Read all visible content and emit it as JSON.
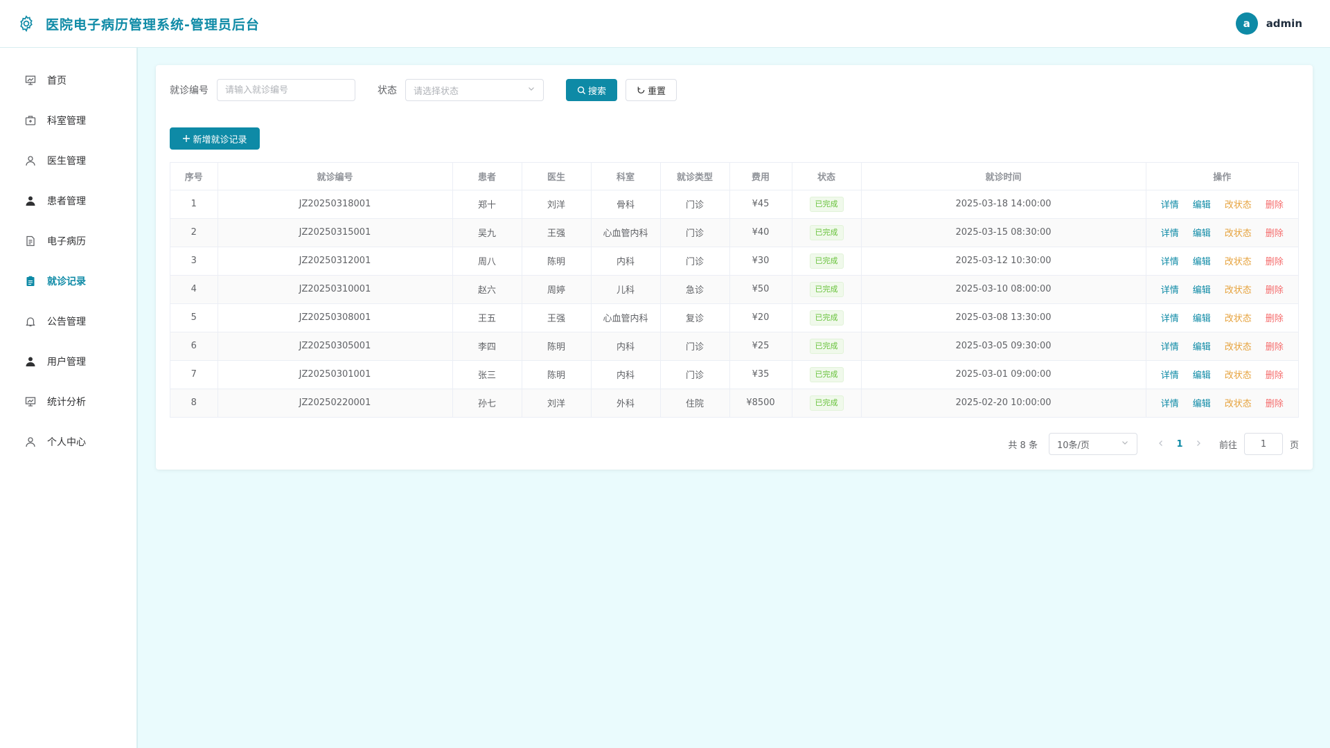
{
  "header": {
    "title": "医院电子病历管理系统-管理员后台",
    "avatar_letter": "a",
    "username": "admin"
  },
  "sidebar": {
    "items": [
      {
        "label": "首页",
        "icon": "dashboard-icon"
      },
      {
        "label": "科室管理",
        "icon": "department-icon"
      },
      {
        "label": "医生管理",
        "icon": "doctor-icon"
      },
      {
        "label": "患者管理",
        "icon": "patient-icon"
      },
      {
        "label": "电子病历",
        "icon": "document-icon"
      },
      {
        "label": "就诊记录",
        "icon": "clipboard-icon",
        "active": true
      },
      {
        "label": "公告管理",
        "icon": "bell-icon"
      },
      {
        "label": "用户管理",
        "icon": "user-icon"
      },
      {
        "label": "统计分析",
        "icon": "chart-icon"
      },
      {
        "label": "个人中心",
        "icon": "profile-icon"
      }
    ]
  },
  "filters": {
    "visit_no_label": "就诊编号",
    "visit_no_placeholder": "请输入就诊编号",
    "status_label": "状态",
    "status_placeholder": "请选择状态",
    "search_label": "搜索",
    "reset_label": "重置"
  },
  "toolbar": {
    "add_label": "新增就诊记录"
  },
  "table": {
    "columns": [
      "序号",
      "就诊编号",
      "患者",
      "医生",
      "科室",
      "就诊类型",
      "费用",
      "状态",
      "就诊时间",
      "操作"
    ],
    "actions": {
      "detail": "详情",
      "edit": "编辑",
      "change_status": "改状态",
      "delete": "删除"
    },
    "rows": [
      {
        "index": "1",
        "visit_no": "JZ20250318001",
        "patient": "郑十",
        "doctor": "刘洋",
        "department": "骨科",
        "type": "门诊",
        "fee": "¥45",
        "status": "已完成",
        "time": "2025-03-18 14:00:00"
      },
      {
        "index": "2",
        "visit_no": "JZ20250315001",
        "patient": "吴九",
        "doctor": "王强",
        "department": "心血管内科",
        "type": "门诊",
        "fee": "¥40",
        "status": "已完成",
        "time": "2025-03-15 08:30:00"
      },
      {
        "index": "3",
        "visit_no": "JZ20250312001",
        "patient": "周八",
        "doctor": "陈明",
        "department": "内科",
        "type": "门诊",
        "fee": "¥30",
        "status": "已完成",
        "time": "2025-03-12 10:30:00"
      },
      {
        "index": "4",
        "visit_no": "JZ20250310001",
        "patient": "赵六",
        "doctor": "周婷",
        "department": "儿科",
        "type": "急诊",
        "fee": "¥50",
        "status": "已完成",
        "time": "2025-03-10 08:00:00"
      },
      {
        "index": "5",
        "visit_no": "JZ20250308001",
        "patient": "王五",
        "doctor": "王强",
        "department": "心血管内科",
        "type": "复诊",
        "fee": "¥20",
        "status": "已完成",
        "time": "2025-03-08 13:30:00"
      },
      {
        "index": "6",
        "visit_no": "JZ20250305001",
        "patient": "李四",
        "doctor": "陈明",
        "department": "内科",
        "type": "门诊",
        "fee": "¥25",
        "status": "已完成",
        "time": "2025-03-05 09:30:00"
      },
      {
        "index": "7",
        "visit_no": "JZ20250301001",
        "patient": "张三",
        "doctor": "陈明",
        "department": "内科",
        "type": "门诊",
        "fee": "¥35",
        "status": "已完成",
        "time": "2025-03-01 09:00:00"
      },
      {
        "index": "8",
        "visit_no": "JZ20250220001",
        "patient": "孙七",
        "doctor": "刘洋",
        "department": "外科",
        "type": "住院",
        "fee": "¥8500",
        "status": "已完成",
        "time": "2025-02-20 10:00:00"
      }
    ]
  },
  "pagination": {
    "total_text": "共 8 条",
    "page_size": "10条/页",
    "current_page": "1",
    "goto_label": "前往",
    "goto_value": "1",
    "page_unit": "页"
  },
  "colors": {
    "primary": "#0e8aa6",
    "success": "#67c23a",
    "warning": "#e6a23c",
    "danger": "#f56c6c"
  }
}
